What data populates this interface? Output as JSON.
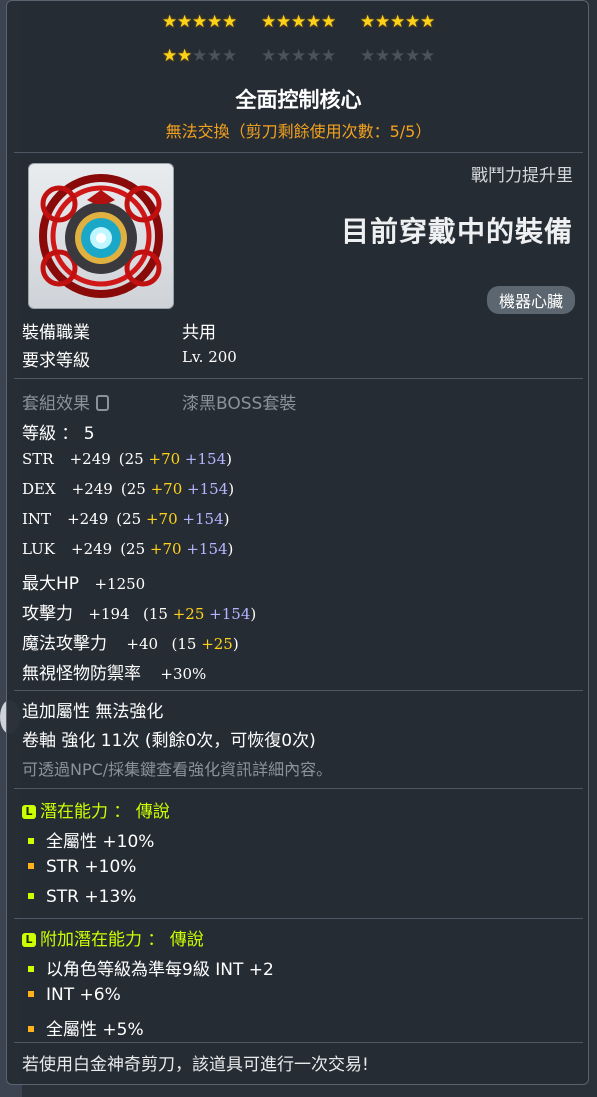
{
  "stars": {
    "row1": [
      5,
      5,
      5
    ],
    "row2": [
      2,
      0,
      0
    ],
    "per_group": 5,
    "glyph": "★"
  },
  "item": {
    "name": "全面控制核心",
    "trade_note": "無法交換（剪刀剩餘使用次數：5/5）",
    "combat_power_label": "戰鬥力提升里",
    "equipped_label": "目前穿戴中的裝備",
    "category": "機器心臟",
    "icon": "control-core-icon"
  },
  "basic": {
    "job_label": "裝備職業",
    "job_value": "共用",
    "level_label": "要求等級",
    "level_value": "Lv. 200",
    "set_label": "套組效果",
    "set_value": "漆黑BOSS套裝",
    "grade_line": "等級 ： 5"
  },
  "stats": [
    {
      "name": "STR",
      "total": "+249",
      "base": "(25 ",
      "bonus": "+70",
      "enh": " +154",
      "close": ")"
    },
    {
      "name": "DEX",
      "total": "+249",
      "base": "(25 ",
      "bonus": "+70",
      "enh": " +154",
      "close": ")"
    },
    {
      "name": "INT",
      "total": "+249",
      "base": "(25 ",
      "bonus": "+70",
      "enh": " +154",
      "close": ")"
    },
    {
      "name": "LUK",
      "total": "+249",
      "base": "(25 ",
      "bonus": "+70",
      "enh": " +154",
      "close": ")"
    }
  ],
  "maxhp": {
    "name": "最大HP",
    "value": "+1250"
  },
  "attack": {
    "name": "攻擊力",
    "total": "+194",
    "base": "(15 ",
    "bonus": "+25",
    "enh": " +154",
    "close": ")"
  },
  "magic": {
    "name": "魔法攻擊力",
    "total": "+40",
    "base": "(15 ",
    "bonus": "+25",
    "close": ")"
  },
  "ignore_def": {
    "name": "無視怪物防禦率",
    "value": "+30%"
  },
  "extra": {
    "bonus_line": "追加屬性 無法強化",
    "scroll_line": "卷軸 強化 11次 (剩餘0次，可恢復0次)",
    "hint_line": "可透過NPC/採集鍵查看強化資訊詳細內容。"
  },
  "potential": {
    "badge": "L",
    "title": "潛在能力 ： 傳說",
    "lines": [
      "全屬性 +10%",
      "STR +10%",
      "STR +13%"
    ]
  },
  "additional": {
    "badge": "L",
    "title": "附加潛在能力 ： 傳說",
    "lines": [
      "以角色等級為準每9級 INT +2",
      "INT +6%",
      "全屬性 +5%"
    ]
  },
  "footer": "若使用白金神奇剪刀，該道具可進行一次交易!",
  "colors": {
    "gold": "#ffd21a",
    "orange": "#f3a21f",
    "lime": "#ccff00",
    "violet": "#b4b4ff"
  }
}
